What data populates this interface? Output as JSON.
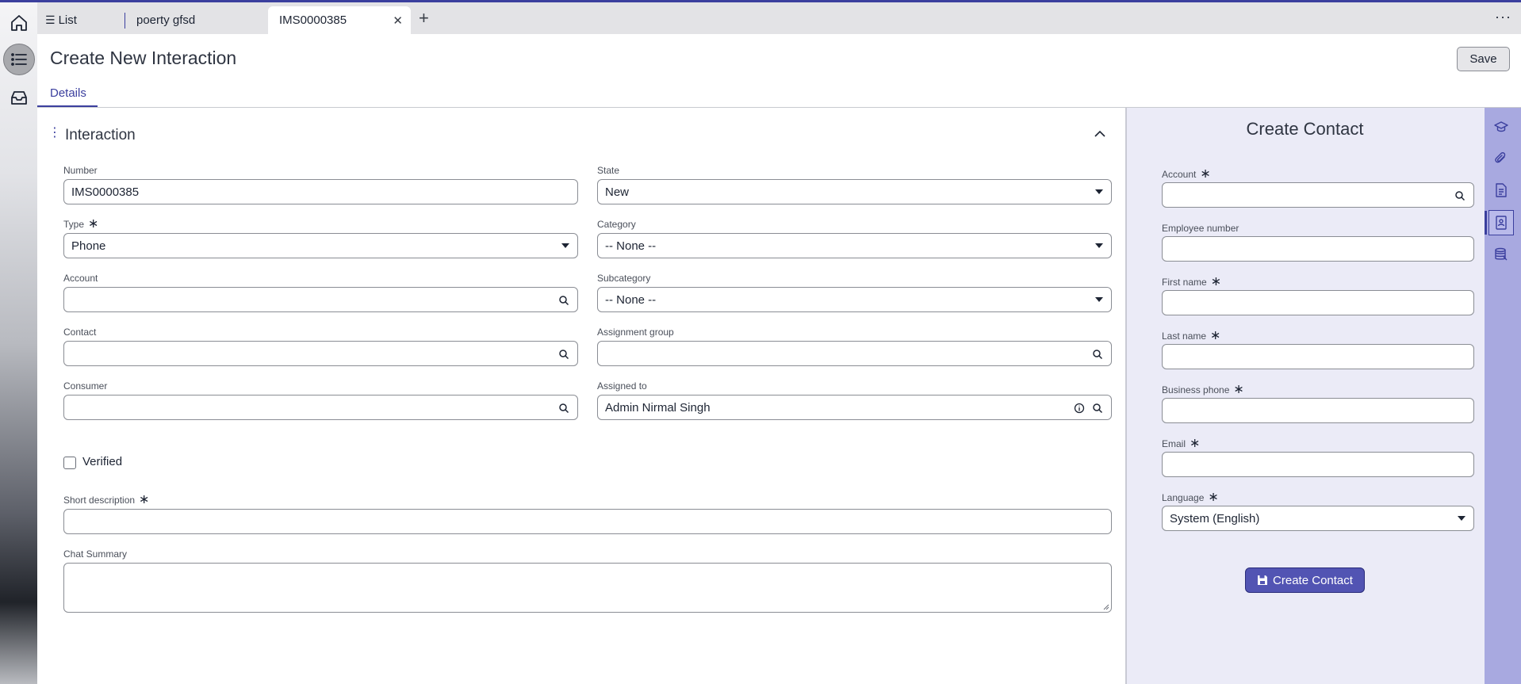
{
  "tabs": [
    {
      "label": "List"
    },
    {
      "label": "poerty gfsd"
    },
    {
      "label": "IMS0000385"
    }
  ],
  "header": {
    "title": "Create New Interaction",
    "save_label": "Save",
    "details_tab": "Details"
  },
  "section": {
    "title": "Interaction"
  },
  "form": {
    "number": {
      "label": "Number",
      "value": "IMS0000385"
    },
    "state": {
      "label": "State",
      "value": "New"
    },
    "type": {
      "label": "Type",
      "value": "Phone"
    },
    "category": {
      "label": "Category",
      "value": "-- None --"
    },
    "account": {
      "label": "Account",
      "value": ""
    },
    "subcategory": {
      "label": "Subcategory",
      "value": "-- None --"
    },
    "contact": {
      "label": "Contact",
      "value": ""
    },
    "assignment_group": {
      "label": "Assignment group",
      "value": ""
    },
    "consumer": {
      "label": "Consumer",
      "value": ""
    },
    "assigned_to": {
      "label": "Assigned to",
      "value": "Admin Nirmal Singh"
    },
    "verified": {
      "label": "Verified",
      "checked": false
    },
    "short_description": {
      "label": "Short description",
      "value": ""
    },
    "chat_summary": {
      "label": "Chat Summary",
      "value": ""
    }
  },
  "contact_panel": {
    "title": "Create Contact",
    "account": {
      "label": "Account"
    },
    "employee_number": {
      "label": "Employee number"
    },
    "first_name": {
      "label": "First name"
    },
    "last_name": {
      "label": "Last name"
    },
    "business_phone": {
      "label": "Business phone"
    },
    "email": {
      "label": "Email"
    },
    "language": {
      "label": "Language",
      "value": "System (English)"
    },
    "create_label": "Create Contact"
  },
  "icons": {
    "rail": [
      "home-icon",
      "list-icon",
      "inbox-icon"
    ],
    "right_rail": [
      "graduation-cap-icon",
      "paperclip-icon",
      "document-icon",
      "contact-book-icon",
      "database-icon"
    ]
  },
  "colors": {
    "accent": "#3b3f9e",
    "panel_bg": "#ebebf7",
    "right_rail_bg": "#a8a9e0",
    "primary_button": "#5254b3"
  }
}
